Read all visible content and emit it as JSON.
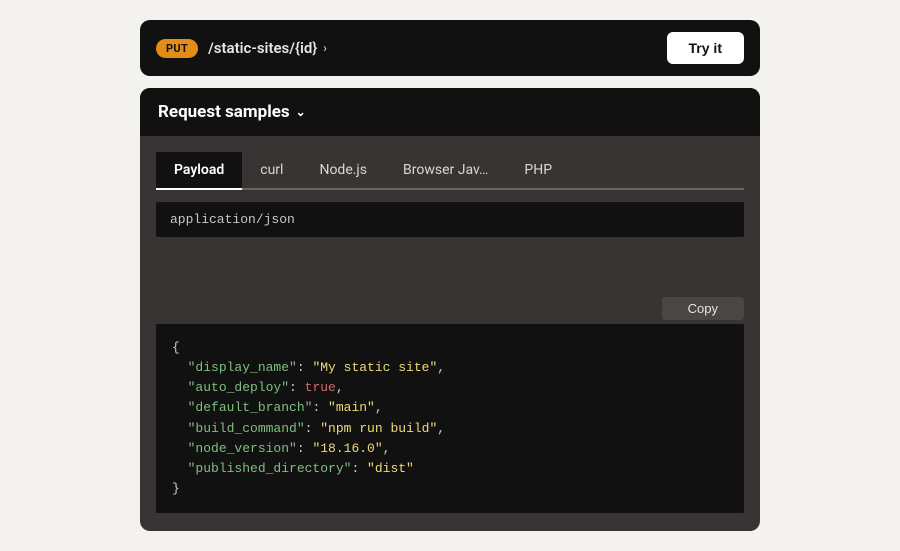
{
  "header": {
    "method": "PUT",
    "path": "/static-sites/{id}",
    "try_label": "Try it"
  },
  "samples": {
    "title": "Request samples",
    "tabs": [
      {
        "label": "Payload"
      },
      {
        "label": "curl"
      },
      {
        "label": "Node.js"
      },
      {
        "label": "Browser Jav…"
      },
      {
        "label": "PHP"
      }
    ],
    "mime": "application/json",
    "copy_label": "Copy",
    "payload": {
      "display_name": "My static site",
      "auto_deploy": true,
      "default_branch": "main",
      "build_command": "npm run build",
      "node_version": "18.16.0",
      "published_directory": "dist"
    }
  }
}
